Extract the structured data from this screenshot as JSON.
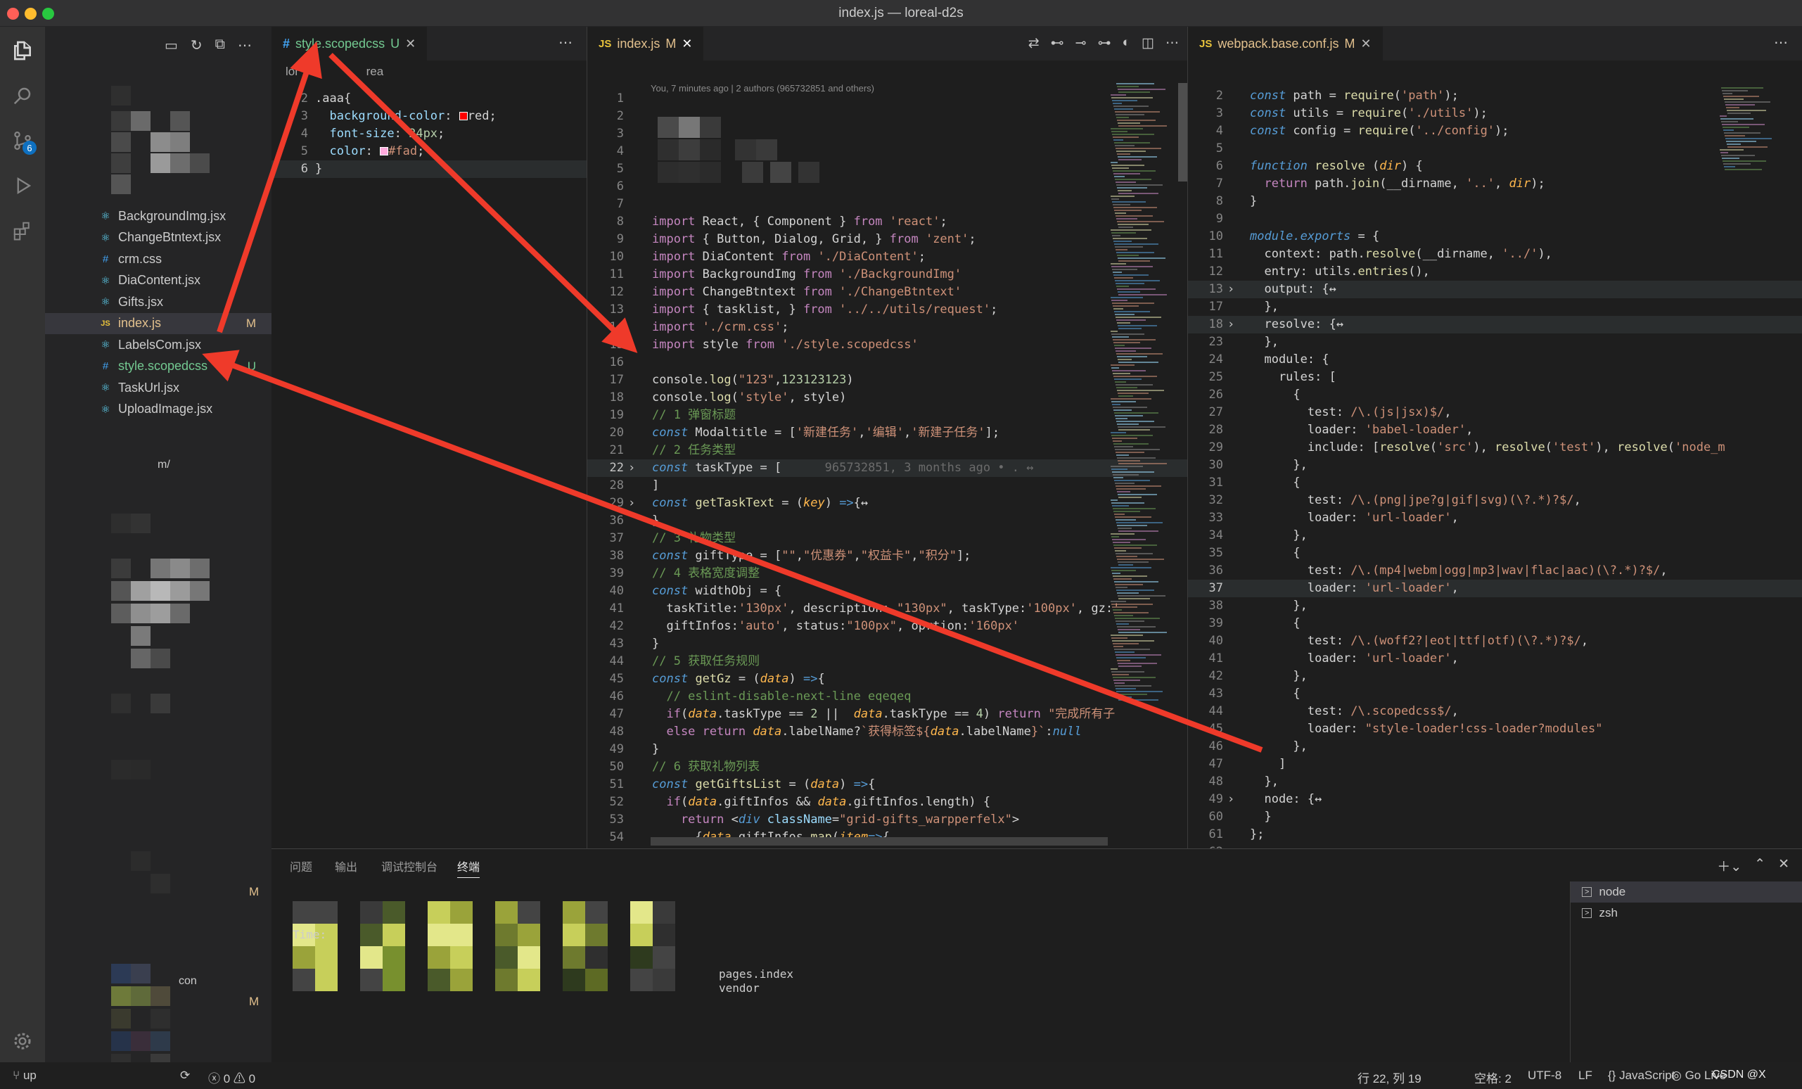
{
  "window": {
    "title": "index.js — loreal-d2s"
  },
  "activity": {
    "scm_badge": "6"
  },
  "explorer": {
    "files": [
      {
        "name": "BackgroundImg.jsx",
        "icon": "react-icon",
        "status": "",
        "color": "#cccccc"
      },
      {
        "name": "ChangeBtntext.jsx",
        "icon": "react-icon",
        "status": "",
        "color": "#cccccc"
      },
      {
        "name": "crm.css",
        "icon": "css-icon",
        "status": "",
        "color": "#cccccc"
      },
      {
        "name": "DiaContent.jsx",
        "icon": "react-icon",
        "status": "",
        "color": "#cccccc"
      },
      {
        "name": "Gifts.jsx",
        "icon": "react-icon",
        "status": "",
        "color": "#cccccc"
      },
      {
        "name": "index.js",
        "icon": "js-icon",
        "status": "M",
        "color": "#e2c08d"
      },
      {
        "name": "LabelsCom.jsx",
        "icon": "react-icon",
        "status": "",
        "color": "#cccccc"
      },
      {
        "name": "style.scopedcss",
        "icon": "css-icon",
        "status": "U",
        "color": "#73c991"
      },
      {
        "name": "TaskUrl.jsx",
        "icon": "react-icon",
        "status": "",
        "color": "#cccccc"
      },
      {
        "name": "UploadImage.jsx",
        "icon": "react-icon",
        "status": "",
        "color": "#cccccc"
      }
    ],
    "extra_status": [
      "M",
      "M"
    ],
    "fragment1": "m/",
    "fragment2": "con"
  },
  "editor1": {
    "tab": "style.scopedcss",
    "tab_status": "U",
    "bread1": "lor",
    "bread2": "rea",
    "lines": [
      {
        "n": "2",
        "h": "<span class='w'>.aaa{</span>"
      },
      {
        "n": "3",
        "h": "  <span class='v'>background-color</span><span class='w'>: </span><span style='display:inline-block;width:12px;height:12px;background:red;border:1px solid #fff;vertical-align:middle'></span><span class='w'>red;</span>"
      },
      {
        "n": "4",
        "h": "  <span class='v'>font-size</span><span class='w'>: </span><span class='n'>24px</span><span class='w'>;</span>"
      },
      {
        "n": "5",
        "h": "  <span class='v'>color</span><span class='w'>: </span><span style='display:inline-block;width:12px;height:12px;background:#ffaadd;border:1px solid #fff;vertical-align:middle'></span><span class='s'>#fad</span><span class='w'>;</span>"
      },
      {
        "n": "6",
        "h": "<span class='w'>}</span>"
      }
    ]
  },
  "editor2": {
    "tab": "index.js",
    "tab_status": "M",
    "blame": "You, 7 minutes ago | 2 authors (965732851 and others)",
    "lines": [
      {
        "n": "1",
        "h": ""
      },
      {
        "n": "2",
        "h": ""
      },
      {
        "n": "3",
        "h": ""
      },
      {
        "n": "4",
        "h": ""
      },
      {
        "n": "5",
        "h": ""
      },
      {
        "n": "6",
        "h": ""
      },
      {
        "n": "7",
        "h": ""
      },
      {
        "n": "8",
        "h": "<span class='kw'>import</span><span class='w'> React, { Component } </span><span class='kw'>from</span><span class='s'> 'react'</span><span class='w'>;</span>"
      },
      {
        "n": "9",
        "h": "<span class='kw'>import</span><span class='w'> { Button, Dialog, Grid, } </span><span class='kw'>from</span><span class='s'> 'zent'</span><span class='w'>;</span>"
      },
      {
        "n": "10",
        "h": "<span class='kw'>import</span><span class='w'> DiaContent </span><span class='kw'>from</span><span class='s'> './DiaContent'</span><span class='w'>;</span>"
      },
      {
        "n": "11",
        "h": "<span class='kw'>import</span><span class='w'> BackgroundImg </span><span class='kw'>from</span><span class='s'> './BackgroundImg'</span>"
      },
      {
        "n": "12",
        "h": "<span class='kw'>import</span><span class='w'> ChangeBtntext </span><span class='kw'>from</span><span class='s'> './ChangeBtntext'</span>"
      },
      {
        "n": "13",
        "h": "<span class='kw'>import</span><span class='w'> { tasklist, } </span><span class='kw'>from</span><span class='s'> '../../utils/request'</span><span class='w'>;</span>"
      },
      {
        "n": "14",
        "h": "<span class='kw'>import</span><span class='s'> './crm.css'</span><span class='w'>;</span>"
      },
      {
        "n": "15",
        "h": "<span class='kw'>import</span><span class='w'> style </span><span class='kw'>from</span><span class='s'> './style.scopedcss'</span>"
      },
      {
        "n": "16",
        "h": ""
      },
      {
        "n": "17",
        "h": "<span class='w'>console.</span><span class='f'>log</span><span class='w'>(</span><span class='s'>\"123\"</span><span class='w'>,</span><span class='n'>123123123</span><span class='w'>)</span>"
      },
      {
        "n": "18",
        "h": "<span class='w'>console.</span><span class='f'>log</span><span class='w'>(</span><span class='s'>'style'</span><span class='w'>, style)</span>"
      },
      {
        "n": "19",
        "h": "<span class='c'>// 1 弹窗标题</span>"
      },
      {
        "n": "20",
        "h": "<span class='k'>const</span><span class='w'> Modaltitle = [</span><span class='s'>'新建任务'</span><span class='w'>,</span><span class='s'>'编辑'</span><span class='w'>,</span><span class='s'>'新建子任务'</span><span class='w'>];</span>"
      },
      {
        "n": "21",
        "h": "<span class='c'>// 2 任务类型</span>"
      },
      {
        "n": "22",
        "h": "<span class='k'>const</span><span class='w'> taskType = [      </span><span style='color:#6b6b6b'>965732851, 3 months ago • . ↔</span>"
      },
      {
        "n": "28",
        "h": "<span class='w'>]</span>"
      },
      {
        "n": "29",
        "h": "<span class='k'>const</span><span class='w'> </span><span class='f'>getTaskText</span><span class='w'> = (</span><span class='p'>key</span><span class='w'>) </span><span class='k'>=&gt;</span><span class='w'>{↔</span>"
      },
      {
        "n": "36",
        "h": "<span class='w'>}</span>"
      },
      {
        "n": "37",
        "h": "<span class='c'>// 3 礼物类型</span>"
      },
      {
        "n": "38",
        "h": "<span class='k'>const</span><span class='w'> giftType = [</span><span class='s'>\"\"</span><span class='w'>,</span><span class='s'>\"优惠券\"</span><span class='w'>,</span><span class='s'>\"权益卡\"</span><span class='w'>,</span><span class='s'>\"积分\"</span><span class='w'>];</span>"
      },
      {
        "n": "39",
        "h": "<span class='c'>// 4 表格宽度调整</span>"
      },
      {
        "n": "40",
        "h": "<span class='k'>const</span><span class='w'> widthObj = {</span>"
      },
      {
        "n": "41",
        "h": "<span class='w'>  taskTitle:</span><span class='s'>'130px'</span><span class='w'>, description: </span><span class='s'>\"130px\"</span><span class='w'>, taskType:</span><span class='s'>'100px'</span><span class='w'>, gz:</span><span class='s'>'</span>"
      },
      {
        "n": "42",
        "h": "<span class='w'>  giftInfos:</span><span class='s'>'auto'</span><span class='w'>, status:</span><span class='s'>\"100px\"</span><span class='w'>, oprtion:</span><span class='s'>'160px'</span>"
      },
      {
        "n": "43",
        "h": "<span class='w'>}</span>"
      },
      {
        "n": "44",
        "h": "<span class='c'>// 5 获取任务规则</span>"
      },
      {
        "n": "45",
        "h": "<span class='k'>const</span><span class='w'> </span><span class='f'>getGz</span><span class='w'> = (</span><span class='p'>data</span><span class='w'>) </span><span class='k'>=&gt;</span><span class='w'>{</span>"
      },
      {
        "n": "46",
        "h": "<span class='c'>  // eslint-disable-next-line eqeqeq</span>"
      },
      {
        "n": "47",
        "h": "<span class='kw'>  if</span><span class='w'>(</span><span class='p'>data</span><span class='w'>.taskType == </span><span class='n'>2</span><span class='w'> ||  </span><span class='p'>data</span><span class='w'>.taskType == </span><span class='n'>4</span><span class='w'>) </span><span class='kw'>return</span><span class='s'> \"完成所有子</span>"
      },
      {
        "n": "48",
        "h": "<span class='kw'>  else return</span><span class='w'> </span><span class='p'>data</span><span class='w'>.labelName?</span><span class='s'>`获得标签${</span><span class='p'>data</span><span class='w'>.labelName</span><span class='s'>}`</span><span class='w'>:</span><span class='k'>null</span>"
      },
      {
        "n": "49",
        "h": "<span class='w'>}</span>"
      },
      {
        "n": "50",
        "h": "<span class='c'>// 6 获取礼物列表</span>"
      },
      {
        "n": "51",
        "h": "<span class='k'>const</span><span class='w'> </span><span class='f'>getGiftsList</span><span class='w'> = (</span><span class='p'>data</span><span class='w'>) </span><span class='k'>=&gt;</span><span class='w'>{</span>"
      },
      {
        "n": "52",
        "h": "<span class='kw'>  if</span><span class='w'>(</span><span class='p'>data</span><span class='w'>.giftInfos &amp;&amp; </span><span class='p'>data</span><span class='w'>.giftInfos.length) {</span>"
      },
      {
        "n": "53",
        "h": "<span class='kw'>    return</span><span class='w'> &lt;</span><span class='k'>div</span><span class='v'> className</span><span class='w'>=</span><span class='s'>\"grid-gifts_warpperfelx\"</span><span class='w'>&gt;</span>"
      },
      {
        "n": "54",
        "h": "<span class='w'>      {</span><span class='p'>data</span><span class='w'>.giftInfos.</span><span class='f'>map</span><span class='w'>(</span><span class='p'>item</span><span class='k'>=&gt;</span><span class='w'>{</span>"
      }
    ]
  },
  "editor3": {
    "tab": "webpack.base.conf.js",
    "tab_status": "M",
    "lines": [
      {
        "n": "2",
        "h": "<span class='k'>const</span><span class='w'> path = </span><span class='f'>require</span><span class='w'>(</span><span class='s'>'path'</span><span class='w'>);</span>"
      },
      {
        "n": "3",
        "h": "<span class='k'>const</span><span class='w'> utils = </span><span class='f'>require</span><span class='w'>(</span><span class='s'>'./utils'</span><span class='w'>);</span>"
      },
      {
        "n": "4",
        "h": "<span class='k'>const</span><span class='w'> config = </span><span class='f'>require</span><span class='w'>(</span><span class='s'>'../config'</span><span class='w'>);</span>"
      },
      {
        "n": "5",
        "h": ""
      },
      {
        "n": "6",
        "h": "<span class='k'>function</span><span class='w'> </span><span class='f'>resolve</span><span class='w'> (</span><span class='p'>dir</span><span class='w'>) {</span>"
      },
      {
        "n": "7",
        "h": "<span class='kw'>  return</span><span class='w'> path.</span><span class='f'>join</span><span class='w'>(__dirname, </span><span class='s'>'..'</span><span class='w'>, </span><span class='p'>dir</span><span class='w'>);</span>"
      },
      {
        "n": "8",
        "h": "<span class='w'>}</span>"
      },
      {
        "n": "9",
        "h": ""
      },
      {
        "n": "10",
        "h": "<span class='k'>module.exports</span><span class='w'> = {</span>"
      },
      {
        "n": "11",
        "h": "<span class='w'>  context: path.</span><span class='f'>resolve</span><span class='w'>(__dirname, </span><span class='s'>'../'</span><span class='w'>),</span>"
      },
      {
        "n": "12",
        "h": "<span class='w'>  entry: utils.</span><span class='f'>entries</span><span class='w'>(),</span>"
      },
      {
        "n": "13",
        "h": "<span class='w'>  output: {↔</span>"
      },
      {
        "n": "17",
        "h": "<span class='w'>  },</span>"
      },
      {
        "n": "18",
        "h": "<span class='w'>  resolve: {↔</span>"
      },
      {
        "n": "23",
        "h": "<span class='w'>  },</span>"
      },
      {
        "n": "24",
        "h": "<span class='w'>  module: {</span>"
      },
      {
        "n": "25",
        "h": "<span class='w'>    rules: [</span>"
      },
      {
        "n": "26",
        "h": "<span class='w'>      {</span>"
      },
      {
        "n": "27",
        "h": "<span class='w'>        test: </span><span class='s'>/\\.(js|jsx)$/</span><span class='w'>,</span>"
      },
      {
        "n": "28",
        "h": "<span class='w'>        loader: </span><span class='s'>'babel-loader'</span><span class='w'>,</span>"
      },
      {
        "n": "29",
        "h": "<span class='w'>        include: [</span><span class='f'>resolve</span><span class='w'>(</span><span class='s'>'src'</span><span class='w'>), </span><span class='f'>resolve</span><span class='w'>(</span><span class='s'>'test'</span><span class='w'>), </span><span class='f'>resolve</span><span class='w'>(</span><span class='s'>'node_m</span>"
      },
      {
        "n": "30",
        "h": "<span class='w'>      },</span>"
      },
      {
        "n": "31",
        "h": "<span class='w'>      {</span>"
      },
      {
        "n": "32",
        "h": "<span class='w'>        test: </span><span class='s'>/\\.(png|jpe?g|gif|svg)(\\?.*)?$/</span><span class='w'>,</span>"
      },
      {
        "n": "33",
        "h": "<span class='w'>        loader: </span><span class='s'>'url-loader'</span><span class='w'>,</span>"
      },
      {
        "n": "34",
        "h": "<span class='w'>      },</span>"
      },
      {
        "n": "35",
        "h": "<span class='w'>      {</span>"
      },
      {
        "n": "36",
        "h": "<span class='w'>        test: </span><span class='s'>/\\.(mp4|webm|ogg|mp3|wav|flac|aac)(\\?.*)?$/</span><span class='w'>,</span>"
      },
      {
        "n": "37",
        "h": "<span class='w'>        loader: </span><span class='s'>'url-loader'</span><span class='w'>,</span>"
      },
      {
        "n": "38",
        "h": "<span class='w'>      },</span>"
      },
      {
        "n": "39",
        "h": "<span class='w'>      {</span>"
      },
      {
        "n": "40",
        "h": "<span class='w'>        test: </span><span class='s'>/\\.(woff2?|eot|ttf|otf)(\\?.*)?$/</span><span class='w'>,</span>"
      },
      {
        "n": "41",
        "h": "<span class='w'>        loader: </span><span class='s'>'url-loader'</span><span class='w'>,</span>"
      },
      {
        "n": "42",
        "h": "<span class='w'>      },</span>"
      },
      {
        "n": "43",
        "h": "<span class='w'>      {</span>"
      },
      {
        "n": "44",
        "h": "<span class='w'>        test: </span><span class='s'>/\\.scopedcss$/</span><span class='w'>,</span>"
      },
      {
        "n": "45",
        "h": "<span class='w'>        loader: </span><span class='s'>\"style-loader!css-loader?modules\"</span>"
      },
      {
        "n": "46",
        "h": "<span class='w'>      },</span>"
      },
      {
        "n": "47",
        "h": "<span class='w'>    ]</span>"
      },
      {
        "n": "48",
        "h": "<span class='w'>  },</span>"
      },
      {
        "n": "49",
        "h": "<span class='w'>  node: {↔</span>"
      },
      {
        "n": "60",
        "h": "<span class='w'>  }</span>"
      },
      {
        "n": "61",
        "h": "<span class='w'>};</span>"
      },
      {
        "n": "62",
        "h": ""
      }
    ]
  },
  "panel": {
    "tabs": [
      "问题",
      "输出",
      "调试控制台",
      "终端"
    ],
    "terminals": [
      "node",
      "zsh"
    ],
    "time_label": "Time:",
    "out1": "pages.index",
    "out2": "vendor"
  },
  "status": {
    "branch": "up",
    "errors": "0",
    "warnings": "0",
    "position": "行 22, 列 19",
    "spaces": "空格: 2",
    "encoding": "UTF-8",
    "eol": "LF",
    "language": "JavaScript",
    "golive": "Go Live",
    "watermark": "CSDN @X"
  }
}
